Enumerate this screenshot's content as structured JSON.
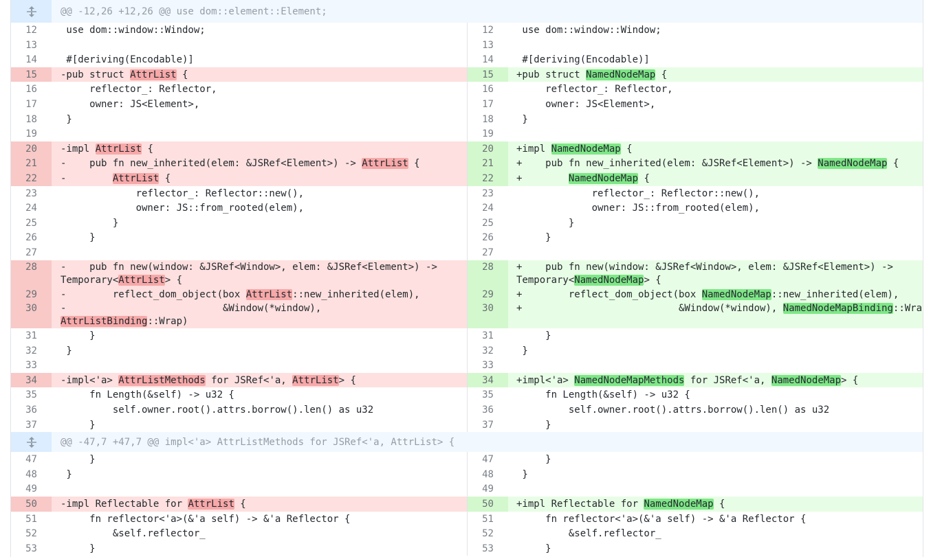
{
  "hunks": [
    {
      "header": "@@ -12,26 +12,26 @@ use dom::element::Element;",
      "icon": "expand-icon",
      "rows": [
        {
          "type": "ctx",
          "l": "12",
          "r": "12",
          "lt": " use dom::window::Window;",
          "rt": " use dom::window::Window;"
        },
        {
          "type": "ctx",
          "l": "13",
          "r": "13",
          "lt": "",
          "rt": ""
        },
        {
          "type": "ctx",
          "l": "14",
          "r": "14",
          "lt": " #[deriving(Encodable)]",
          "rt": " #[deriving(Encodable)]"
        },
        {
          "type": "chg",
          "l": "15",
          "r": "15",
          "lt": [
            "-pub struct ",
            {
              "h": "AttrList"
            },
            " {"
          ],
          "rt": [
            "+pub struct ",
            {
              "h": "NamedNodeMap"
            },
            " {"
          ]
        },
        {
          "type": "ctx",
          "l": "16",
          "r": "16",
          "lt": "     reflector_: Reflector,",
          "rt": "     reflector_: Reflector,"
        },
        {
          "type": "ctx",
          "l": "17",
          "r": "17",
          "lt": "     owner: JS<Element>,",
          "rt": "     owner: JS<Element>,"
        },
        {
          "type": "ctx",
          "l": "18",
          "r": "18",
          "lt": " }",
          "rt": " }"
        },
        {
          "type": "ctx",
          "l": "19",
          "r": "19",
          "lt": "",
          "rt": ""
        },
        {
          "type": "chg",
          "l": "20",
          "r": "20",
          "lt": [
            "-impl ",
            {
              "h": "AttrList"
            },
            " {"
          ],
          "rt": [
            "+impl ",
            {
              "h": "NamedNodeMap"
            },
            " {"
          ]
        },
        {
          "type": "chg",
          "l": "21",
          "r": "21",
          "lt": [
            "-    pub fn new_inherited(elem: &JSRef<Element>) -> ",
            {
              "h": "AttrList"
            },
            " {"
          ],
          "rt": [
            "+    pub fn new_inherited(elem: &JSRef<Element>) -> ",
            {
              "h": "NamedNodeMap"
            },
            " {"
          ]
        },
        {
          "type": "chg",
          "l": "22",
          "r": "22",
          "lt": [
            "-        ",
            {
              "h": "AttrList"
            },
            " {"
          ],
          "rt": [
            "+        ",
            {
              "h": "NamedNodeMap"
            },
            " {"
          ]
        },
        {
          "type": "ctx",
          "l": "23",
          "r": "23",
          "lt": "             reflector_: Reflector::new(),",
          "rt": "             reflector_: Reflector::new(),"
        },
        {
          "type": "ctx",
          "l": "24",
          "r": "24",
          "lt": "             owner: JS::from_rooted(elem),",
          "rt": "             owner: JS::from_rooted(elem),"
        },
        {
          "type": "ctx",
          "l": "25",
          "r": "25",
          "lt": "         }",
          "rt": "         }"
        },
        {
          "type": "ctx",
          "l": "26",
          "r": "26",
          "lt": "     }",
          "rt": "     }"
        },
        {
          "type": "ctx",
          "l": "27",
          "r": "27",
          "lt": "",
          "rt": ""
        },
        {
          "type": "chg2",
          "l": "28",
          "r": "28",
          "lt": [
            "-    pub fn new(window: &JSRef<Window>, elem: &JSRef<Element>) ->\nTemporary<",
            {
              "h": "AttrList"
            },
            "> {"
          ],
          "rt": [
            "+    pub fn new(window: &JSRef<Window>, elem: &JSRef<Element>) ->\nTemporary<",
            {
              "h": "NamedNodeMap"
            },
            "> {"
          ]
        },
        {
          "type": "chg",
          "l": "29",
          "r": "29",
          "lt": [
            "-        reflect_dom_object(box ",
            {
              "h": "AttrList"
            },
            "::new_inherited(elem),"
          ],
          "rt": [
            "+        reflect_dom_object(box ",
            {
              "h": "NamedNodeMap"
            },
            "::new_inherited(elem),"
          ]
        },
        {
          "type": "chg2",
          "l": "30",
          "r": "30",
          "lt": [
            "-                           &Window(*window),\n",
            {
              "h": "AttrListBinding"
            },
            "::Wrap)"
          ],
          "rt": [
            "+                           &Window(*window), ",
            {
              "h": "NamedNodeMapBinding"
            },
            "::Wrap)"
          ]
        },
        {
          "type": "ctx",
          "l": "31",
          "r": "31",
          "lt": "     }",
          "rt": "     }"
        },
        {
          "type": "ctx",
          "l": "32",
          "r": "32",
          "lt": " }",
          "rt": " }"
        },
        {
          "type": "ctx",
          "l": "33",
          "r": "33",
          "lt": "",
          "rt": ""
        },
        {
          "type": "chg",
          "l": "34",
          "r": "34",
          "lt": [
            "-impl<'a> ",
            {
              "h": "AttrListMethods"
            },
            " for JSRef<'a, ",
            {
              "h": "AttrList"
            },
            "> {"
          ],
          "rt": [
            "+impl<'a> ",
            {
              "h": "NamedNodeMapMethods"
            },
            " for JSRef<'a, ",
            {
              "h": "NamedNodeMap"
            },
            "> {"
          ]
        },
        {
          "type": "ctx",
          "l": "35",
          "r": "35",
          "lt": "     fn Length(&self) -> u32 {",
          "rt": "     fn Length(&self) -> u32 {"
        },
        {
          "type": "ctx",
          "l": "36",
          "r": "36",
          "lt": "         self.owner.root().attrs.borrow().len() as u32",
          "rt": "         self.owner.root().attrs.borrow().len() as u32"
        },
        {
          "type": "ctx",
          "l": "37",
          "r": "37",
          "lt": "     }",
          "rt": "     }"
        }
      ]
    },
    {
      "header": "@@ -47,7 +47,7 @@ impl<'a> AttrListMethods for JSRef<'a, AttrList> {",
      "icon": "expand-icon",
      "rows": [
        {
          "type": "ctx",
          "l": "47",
          "r": "47",
          "lt": "     }",
          "rt": "     }"
        },
        {
          "type": "ctx",
          "l": "48",
          "r": "48",
          "lt": " }",
          "rt": " }"
        },
        {
          "type": "ctx",
          "l": "49",
          "r": "49",
          "lt": "",
          "rt": ""
        },
        {
          "type": "chg",
          "l": "50",
          "r": "50",
          "lt": [
            "-impl Reflectable for ",
            {
              "h": "AttrList"
            },
            " {"
          ],
          "rt": [
            "+impl Reflectable for ",
            {
              "h": "NamedNodeMap"
            },
            " {"
          ]
        },
        {
          "type": "ctx",
          "l": "51",
          "r": "51",
          "lt": "     fn reflector<'a>(&'a self) -> &'a Reflector {",
          "rt": "     fn reflector<'a>(&'a self) -> &'a Reflector {"
        },
        {
          "type": "ctx",
          "l": "52",
          "r": "52",
          "lt": "         &self.reflector_",
          "rt": "         &self.reflector_"
        },
        {
          "type": "ctx",
          "l": "53",
          "r": "53",
          "lt": "     }",
          "rt": "     }"
        }
      ]
    }
  ]
}
